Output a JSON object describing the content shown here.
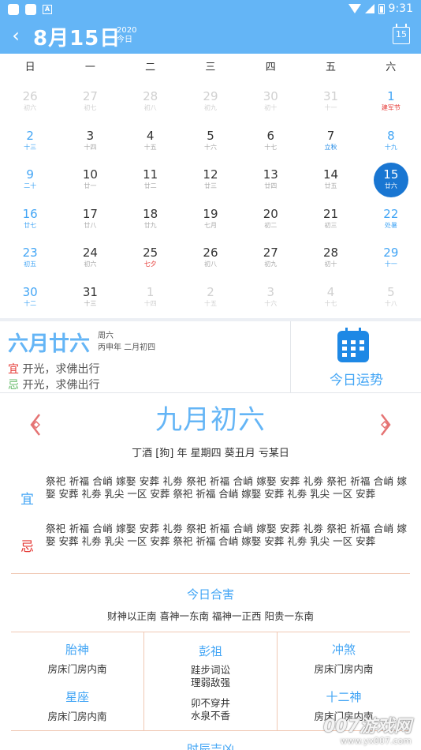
{
  "status_bar": {
    "time": "9:31"
  },
  "header": {
    "date": "8月15日",
    "year": "2020",
    "today": "今日",
    "calendar_button": "15"
  },
  "weekdays": [
    "日",
    "一",
    "二",
    "三",
    "四",
    "五",
    "六"
  ],
  "calendar": [
    [
      {
        "d": "26",
        "l": "初六",
        "t": "other"
      },
      {
        "d": "27",
        "l": "初七",
        "t": "other"
      },
      {
        "d": "28",
        "l": "初八",
        "t": "other"
      },
      {
        "d": "29",
        "l": "初九",
        "t": "other"
      },
      {
        "d": "30",
        "l": "初十",
        "t": "other"
      },
      {
        "d": "31",
        "l": "十一",
        "t": "other"
      },
      {
        "d": "1",
        "l": "建军节",
        "t": "weekend festival-red"
      }
    ],
    [
      {
        "d": "2",
        "l": "十三",
        "t": "weekend"
      },
      {
        "d": "3",
        "l": "十四",
        "t": "normal"
      },
      {
        "d": "4",
        "l": "十五",
        "t": "normal"
      },
      {
        "d": "5",
        "l": "十六",
        "t": "normal"
      },
      {
        "d": "6",
        "l": "十七",
        "t": "normal"
      },
      {
        "d": "7",
        "l": "立秋",
        "t": "normal festival-blue"
      },
      {
        "d": "8",
        "l": "十九",
        "t": "weekend"
      }
    ],
    [
      {
        "d": "9",
        "l": "二十",
        "t": "weekend"
      },
      {
        "d": "10",
        "l": "廿一",
        "t": "normal"
      },
      {
        "d": "11",
        "l": "廿二",
        "t": "normal"
      },
      {
        "d": "12",
        "l": "廿三",
        "t": "normal"
      },
      {
        "d": "13",
        "l": "廿四",
        "t": "normal"
      },
      {
        "d": "14",
        "l": "廿五",
        "t": "normal"
      },
      {
        "d": "15",
        "l": "廿六",
        "t": "selected"
      }
    ],
    [
      {
        "d": "16",
        "l": "廿七",
        "t": "weekend"
      },
      {
        "d": "17",
        "l": "廿八",
        "t": "normal"
      },
      {
        "d": "18",
        "l": "廿九",
        "t": "normal"
      },
      {
        "d": "19",
        "l": "七月",
        "t": "normal"
      },
      {
        "d": "20",
        "l": "初二",
        "t": "normal"
      },
      {
        "d": "21",
        "l": "初三",
        "t": "normal"
      },
      {
        "d": "22",
        "l": "处暑",
        "t": "weekend"
      }
    ],
    [
      {
        "d": "23",
        "l": "初五",
        "t": "weekend"
      },
      {
        "d": "24",
        "l": "初六",
        "t": "normal"
      },
      {
        "d": "25",
        "l": "七夕",
        "t": "normal festival-red"
      },
      {
        "d": "26",
        "l": "初八",
        "t": "normal"
      },
      {
        "d": "27",
        "l": "初九",
        "t": "normal"
      },
      {
        "d": "28",
        "l": "初十",
        "t": "normal"
      },
      {
        "d": "29",
        "l": "十一",
        "t": "weekend"
      }
    ],
    [
      {
        "d": "30",
        "l": "十二",
        "t": "weekend"
      },
      {
        "d": "31",
        "l": "十三",
        "t": "normal"
      },
      {
        "d": "1",
        "l": "十四",
        "t": "other"
      },
      {
        "d": "2",
        "l": "十五",
        "t": "other"
      },
      {
        "d": "3",
        "l": "十六",
        "t": "other"
      },
      {
        "d": "4",
        "l": "十七",
        "t": "other"
      },
      {
        "d": "5",
        "l": "十八",
        "t": "other"
      }
    ]
  ],
  "lunar_panel": {
    "big_date": "六月廿六",
    "weekday": "周六",
    "ganzhi": "丙申年 二月初四",
    "yi_mark": "宜",
    "yi_text": " 开光，求佛出行",
    "ji_mark": "忌",
    "ji_text": " 开光，求佛出行",
    "fortune_label": "今日运势"
  },
  "detail": {
    "title": "九月初六",
    "subtitle": "丁酒 [狗] 年  星期四  葵丑月  亏某日",
    "yi_label": "宜",
    "yi_text": "祭祀 祈福 合峭 嫁娶 安葬 礼劵 祭祀 祈福 合峭 嫁娶 安葬 礼劵 祭祀 祈福 合峭 嫁娶 安葬 礼劵 乳尖 一区 安葬 祭祀 祈福 合峭 嫁娶 安葬 礼劵 乳尖 一区 安葬",
    "ji_label": "忌",
    "ji_text": "祭祀 祈福 合峭 嫁娶 安葬 礼劵 祭祀 祈福 合峭 嫁娶 安葬 礼劵 祭祀 祈福 合峭 嫁娶 安葬 礼劵 乳尖 一区 安葬 祭祀 祈福 合峭 嫁娶 安葬 礼劵 乳尖 一区 安葬",
    "hehai_title": "今日合害",
    "hehai_text": "财神以正南 喜神一东南 福神一正西 阳贵一东南"
  },
  "gods": {
    "taishen_title": "胎神",
    "taishen_text": "房床门房内南",
    "pengzu_title": "彭祖",
    "pengzu_line1": "跬步词讼",
    "pengzu_line2": "理弱敌强",
    "pengzu_line3": "卯不穿井",
    "pengzu_line4": "水泉不香",
    "chongsha_title": "冲煞",
    "chongsha_text": "房床门房内南",
    "xingzuo_title": "星座",
    "xingzuo_text": "房床门房内南",
    "shier_title": "十二神",
    "shier_text": "房床门房内南"
  },
  "bottom_title": "时辰吉凶",
  "watermark": {
    "brand": "007游戏网",
    "url": "www.yx007.com"
  }
}
